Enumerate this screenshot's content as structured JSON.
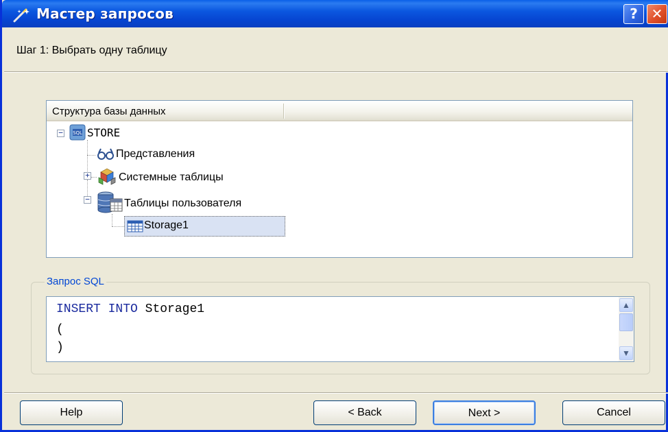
{
  "window": {
    "title": "Мастер запросов",
    "help_button": "?",
    "close_button": "✕"
  },
  "step": {
    "label": "Шаг 1: Выбрать одну таблицу"
  },
  "tree": {
    "column_header": "Структура базы данных",
    "nodes": {
      "root": {
        "label": "STORE",
        "icon": "database-icon",
        "expanded": true
      },
      "views": {
        "label": "Представления",
        "icon": "glasses-icon"
      },
      "system_tables": {
        "label": "Системные таблицы",
        "icon": "cubes-icon",
        "expanded": false
      },
      "user_tables": {
        "label": "Таблицы пользователя",
        "icon": "database-table-icon",
        "expanded": true
      },
      "storage1": {
        "label": "Storage1",
        "icon": "table-grid-icon",
        "selected": true
      }
    }
  },
  "sql": {
    "group_label": "Запрос SQL",
    "lines": {
      "l1_keyword1": "INSERT",
      "l1_keyword2": "INTO",
      "l1_name": "Storage1",
      "l2": "(",
      "l3": ")"
    }
  },
  "buttons": {
    "help": "Help",
    "back": "< Back",
    "next": "Next >",
    "cancel": "Cancel"
  },
  "colors": {
    "titlebar": "#0a52dc",
    "dialog_bg": "#ece9d8",
    "accent_label": "#0046d5",
    "selection": "#d9e2f3",
    "sql_keyword": "#1a2a9e"
  }
}
